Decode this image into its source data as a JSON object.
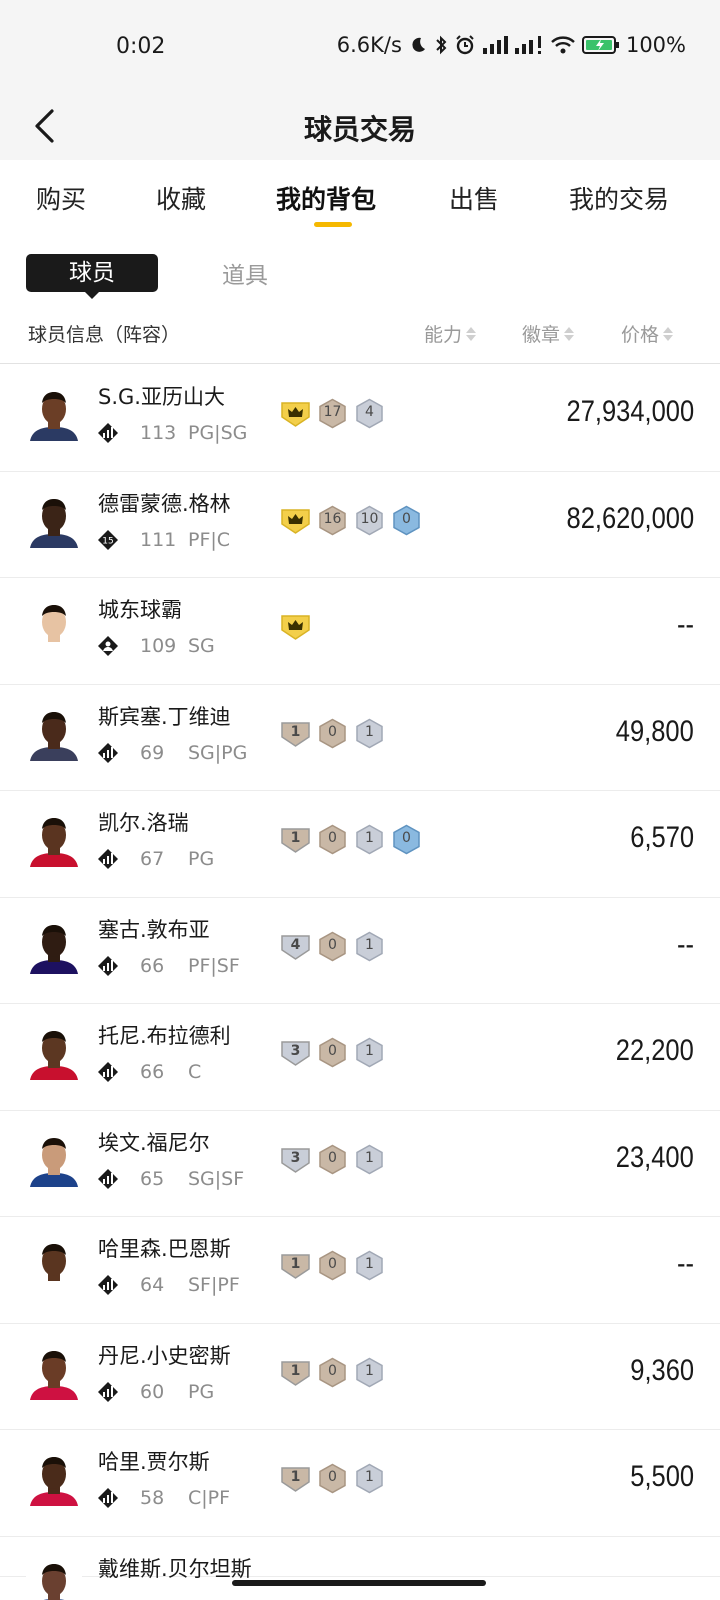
{
  "status": {
    "time": "0:02",
    "network_speed": "6.6K/s",
    "battery": "100%",
    "icons": [
      "moon-icon",
      "bluetooth-icon",
      "alarm-icon",
      "signal-icon",
      "signal-icon",
      "wifi-icon",
      "battery-icon"
    ]
  },
  "header": {
    "title": "球员交易"
  },
  "tabs": [
    "购买",
    "收藏",
    "我的背包",
    "出售",
    "我的交易"
  ],
  "subtabs": {
    "players": "球员",
    "items": "道具"
  },
  "columns": {
    "info": "球员信息（阵容）",
    "ability": "能力",
    "badge": "徽章",
    "price": "价格"
  },
  "players": [
    {
      "name": "S.G.亚历山大",
      "ability": "113",
      "position": "PG|SG",
      "price": "27,934,000",
      "crown": true,
      "tier": "",
      "badge_counts": [
        "17",
        "4"
      ]
    },
    {
      "name": "德雷蒙德.格林",
      "ability": "111",
      "position": "PF|C",
      "price": "82,620,000",
      "crown": true,
      "tier": "",
      "badge_counts": [
        "16",
        "10",
        "0"
      ],
      "rating_badge": "15"
    },
    {
      "name": "城东球霸",
      "ability": "109",
      "position": "SG",
      "price": "--",
      "crown": true,
      "tier": "",
      "badge_counts": []
    },
    {
      "name": "斯宾塞.丁维迪",
      "ability": "69",
      "position": "SG|PG",
      "price": "49,800",
      "crown": false,
      "tier": "1",
      "badge_counts": [
        "0",
        "1"
      ]
    },
    {
      "name": "凯尔.洛瑞",
      "ability": "67",
      "position": "PG",
      "price": "6,570",
      "crown": false,
      "tier": "1",
      "badge_counts": [
        "0",
        "1",
        "0"
      ]
    },
    {
      "name": "塞古.敦布亚",
      "ability": "66",
      "position": "PF|SF",
      "price": "--",
      "crown": false,
      "tier": "4",
      "badge_counts": [
        "0",
        "1"
      ]
    },
    {
      "name": "托尼.布拉德利",
      "ability": "66",
      "position": "C",
      "price": "22,200",
      "crown": false,
      "tier": "3",
      "badge_counts": [
        "0",
        "1"
      ]
    },
    {
      "name": "埃文.福尼尔",
      "ability": "65",
      "position": "SG|SF",
      "price": "23,400",
      "crown": false,
      "tier": "3",
      "badge_counts": [
        "0",
        "1"
      ]
    },
    {
      "name": "哈里森.巴恩斯",
      "ability": "64",
      "position": "SF|PF",
      "price": "--",
      "crown": false,
      "tier": "1",
      "badge_counts": [
        "0",
        "1"
      ]
    },
    {
      "name": "丹尼.小史密斯",
      "ability": "60",
      "position": "PG",
      "price": "9,360",
      "crown": false,
      "tier": "1",
      "badge_counts": [
        "0",
        "1"
      ]
    },
    {
      "name": "哈里.贾尔斯",
      "ability": "58",
      "position": "C|PF",
      "price": "5,500",
      "crown": false,
      "tier": "1",
      "badge_counts": [
        "0",
        "1"
      ]
    },
    {
      "name": "戴维斯.贝尔坦斯",
      "ability": "",
      "position": "",
      "price": "",
      "crown": false,
      "tier": "",
      "badge_counts": []
    }
  ],
  "colors": {
    "accent": "#f5b800",
    "crown_badge": "#f3cf4a",
    "bronze_badge": "#c9b8a6",
    "silver_badge": "#c9ced8",
    "blue_badge": "#8ab9e0"
  }
}
